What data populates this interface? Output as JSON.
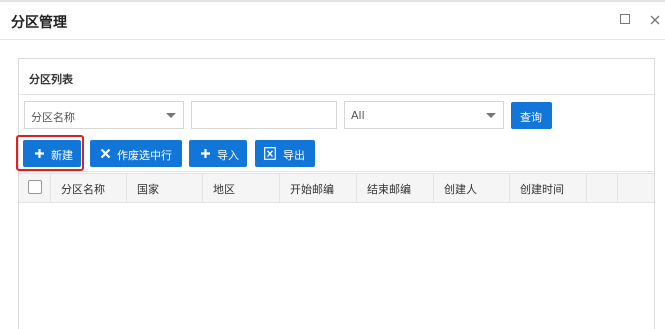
{
  "window": {
    "title": "分区管理",
    "maximize_icon": "maximize-icon",
    "close_icon": "close-icon"
  },
  "panel": {
    "title": "分区列表"
  },
  "filters": {
    "field_select_value": "分区名称",
    "keyword_value": "",
    "status_select_value": "All",
    "query_label": "查询"
  },
  "toolbar": {
    "new_label": "新建",
    "void_label": "作废选中行",
    "import_label": "导入",
    "export_label": "导出"
  },
  "table": {
    "columns": [
      "分区名称",
      "国家",
      "地区",
      "开始邮编",
      "结束邮编",
      "创建人",
      "创建时间"
    ],
    "rows": []
  },
  "colors": {
    "primary": "#1276d8",
    "highlight": "#e02020"
  }
}
